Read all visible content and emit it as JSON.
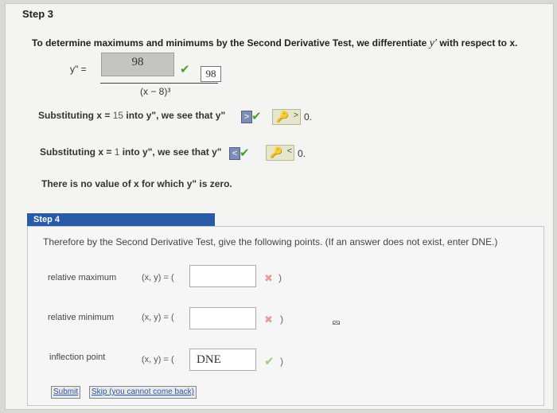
{
  "step3": {
    "title": "Step 3",
    "intro": "To determine maximums and minimums by the Second Derivative Test, we differentiate",
    "intro_var": "y′",
    "intro_end": "with respect to x.",
    "y_label": "y\" =",
    "numerator_value": "98",
    "numerator_answer": "98",
    "denominator": "(x − 8)³",
    "sub1_prefix": "Substituting",
    "sub1_x": "x =",
    "sub1_value": "15",
    "sub1_mid": "into y\", we see that",
    "sub1_y": "y\"",
    "sub1_symbol": ">",
    "sub1_key_symbol": ">",
    "sub1_end": "0.",
    "sub2_prefix": "Substituting",
    "sub2_x": "x =",
    "sub2_value": "1",
    "sub2_mid": "into y\", we see that",
    "sub2_y": "y\"",
    "sub2_symbol": "<",
    "sub2_key_symbol": "<",
    "sub2_end": "0.",
    "no_value_text": "There is no value of x for which  y\"  is zero."
  },
  "step4": {
    "title": "Step 4",
    "intro": "Therefore by the Second Derivative Test, give the following points. (If an answer does not exist, enter DNE.)",
    "rows": [
      {
        "label": "relative maximum",
        "xy": "(x, y)  =  (",
        "value": "",
        "status": "✖",
        "close": ")"
      },
      {
        "label": "relative minimum",
        "xy": "(x, y)  =  (",
        "value": "",
        "status": "✖",
        "close": ")"
      },
      {
        "label": "inflection point",
        "xy": "(x, y)  =  (",
        "value": "DNE",
        "status": "✔",
        "close": ")"
      }
    ],
    "submit_label": "Submit",
    "skip_label": "Skip (you cannot come back)"
  },
  "icons": {
    "check": "check-icon",
    "key": "key-icon",
    "wrong": "x-mark-icon",
    "cursor": "mouse-pointer-icon"
  },
  "colors": {
    "check_green": "#4b9d2f",
    "step_bar_blue": "#2a5aa6",
    "wrong_red": "#e0a0a0"
  }
}
